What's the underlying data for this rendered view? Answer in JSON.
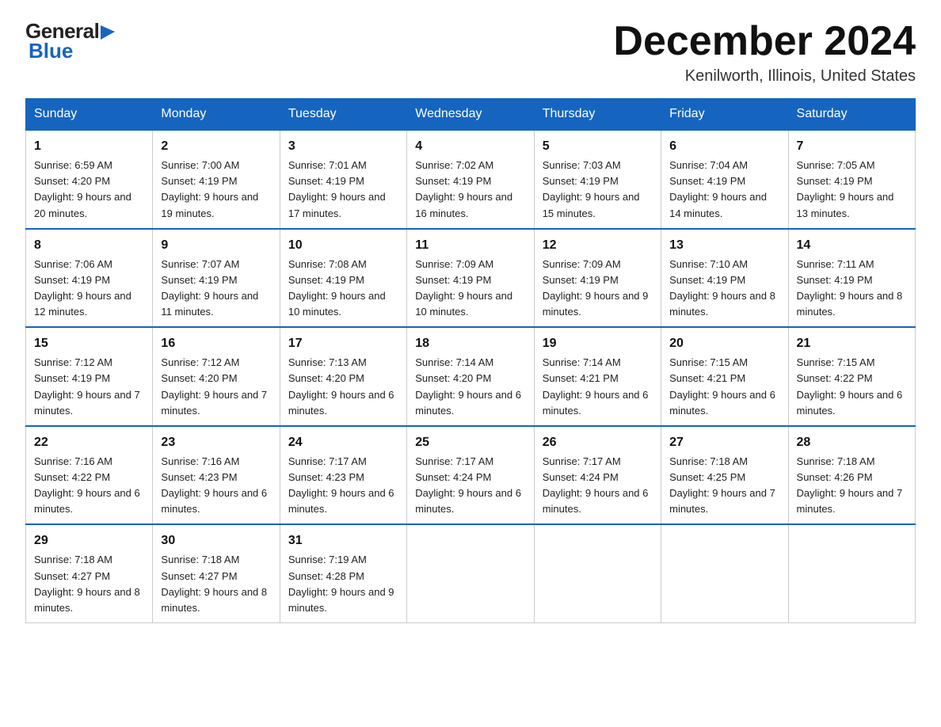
{
  "logo": {
    "general": "General",
    "blue": "Blue",
    "subtitle": "Blue"
  },
  "header": {
    "month_title": "December 2024",
    "location": "Kenilworth, Illinois, United States"
  },
  "days_of_week": [
    "Sunday",
    "Monday",
    "Tuesday",
    "Wednesday",
    "Thursday",
    "Friday",
    "Saturday"
  ],
  "weeks": [
    [
      {
        "day": "1",
        "sunrise": "Sunrise: 6:59 AM",
        "sunset": "Sunset: 4:20 PM",
        "daylight": "Daylight: 9 hours and 20 minutes."
      },
      {
        "day": "2",
        "sunrise": "Sunrise: 7:00 AM",
        "sunset": "Sunset: 4:19 PM",
        "daylight": "Daylight: 9 hours and 19 minutes."
      },
      {
        "day": "3",
        "sunrise": "Sunrise: 7:01 AM",
        "sunset": "Sunset: 4:19 PM",
        "daylight": "Daylight: 9 hours and 17 minutes."
      },
      {
        "day": "4",
        "sunrise": "Sunrise: 7:02 AM",
        "sunset": "Sunset: 4:19 PM",
        "daylight": "Daylight: 9 hours and 16 minutes."
      },
      {
        "day": "5",
        "sunrise": "Sunrise: 7:03 AM",
        "sunset": "Sunset: 4:19 PM",
        "daylight": "Daylight: 9 hours and 15 minutes."
      },
      {
        "day": "6",
        "sunrise": "Sunrise: 7:04 AM",
        "sunset": "Sunset: 4:19 PM",
        "daylight": "Daylight: 9 hours and 14 minutes."
      },
      {
        "day": "7",
        "sunrise": "Sunrise: 7:05 AM",
        "sunset": "Sunset: 4:19 PM",
        "daylight": "Daylight: 9 hours and 13 minutes."
      }
    ],
    [
      {
        "day": "8",
        "sunrise": "Sunrise: 7:06 AM",
        "sunset": "Sunset: 4:19 PM",
        "daylight": "Daylight: 9 hours and 12 minutes."
      },
      {
        "day": "9",
        "sunrise": "Sunrise: 7:07 AM",
        "sunset": "Sunset: 4:19 PM",
        "daylight": "Daylight: 9 hours and 11 minutes."
      },
      {
        "day": "10",
        "sunrise": "Sunrise: 7:08 AM",
        "sunset": "Sunset: 4:19 PM",
        "daylight": "Daylight: 9 hours and 10 minutes."
      },
      {
        "day": "11",
        "sunrise": "Sunrise: 7:09 AM",
        "sunset": "Sunset: 4:19 PM",
        "daylight": "Daylight: 9 hours and 10 minutes."
      },
      {
        "day": "12",
        "sunrise": "Sunrise: 7:09 AM",
        "sunset": "Sunset: 4:19 PM",
        "daylight": "Daylight: 9 hours and 9 minutes."
      },
      {
        "day": "13",
        "sunrise": "Sunrise: 7:10 AM",
        "sunset": "Sunset: 4:19 PM",
        "daylight": "Daylight: 9 hours and 8 minutes."
      },
      {
        "day": "14",
        "sunrise": "Sunrise: 7:11 AM",
        "sunset": "Sunset: 4:19 PM",
        "daylight": "Daylight: 9 hours and 8 minutes."
      }
    ],
    [
      {
        "day": "15",
        "sunrise": "Sunrise: 7:12 AM",
        "sunset": "Sunset: 4:19 PM",
        "daylight": "Daylight: 9 hours and 7 minutes."
      },
      {
        "day": "16",
        "sunrise": "Sunrise: 7:12 AM",
        "sunset": "Sunset: 4:20 PM",
        "daylight": "Daylight: 9 hours and 7 minutes."
      },
      {
        "day": "17",
        "sunrise": "Sunrise: 7:13 AM",
        "sunset": "Sunset: 4:20 PM",
        "daylight": "Daylight: 9 hours and 6 minutes."
      },
      {
        "day": "18",
        "sunrise": "Sunrise: 7:14 AM",
        "sunset": "Sunset: 4:20 PM",
        "daylight": "Daylight: 9 hours and 6 minutes."
      },
      {
        "day": "19",
        "sunrise": "Sunrise: 7:14 AM",
        "sunset": "Sunset: 4:21 PM",
        "daylight": "Daylight: 9 hours and 6 minutes."
      },
      {
        "day": "20",
        "sunrise": "Sunrise: 7:15 AM",
        "sunset": "Sunset: 4:21 PM",
        "daylight": "Daylight: 9 hours and 6 minutes."
      },
      {
        "day": "21",
        "sunrise": "Sunrise: 7:15 AM",
        "sunset": "Sunset: 4:22 PM",
        "daylight": "Daylight: 9 hours and 6 minutes."
      }
    ],
    [
      {
        "day": "22",
        "sunrise": "Sunrise: 7:16 AM",
        "sunset": "Sunset: 4:22 PM",
        "daylight": "Daylight: 9 hours and 6 minutes."
      },
      {
        "day": "23",
        "sunrise": "Sunrise: 7:16 AM",
        "sunset": "Sunset: 4:23 PM",
        "daylight": "Daylight: 9 hours and 6 minutes."
      },
      {
        "day": "24",
        "sunrise": "Sunrise: 7:17 AM",
        "sunset": "Sunset: 4:23 PM",
        "daylight": "Daylight: 9 hours and 6 minutes."
      },
      {
        "day": "25",
        "sunrise": "Sunrise: 7:17 AM",
        "sunset": "Sunset: 4:24 PM",
        "daylight": "Daylight: 9 hours and 6 minutes."
      },
      {
        "day": "26",
        "sunrise": "Sunrise: 7:17 AM",
        "sunset": "Sunset: 4:24 PM",
        "daylight": "Daylight: 9 hours and 6 minutes."
      },
      {
        "day": "27",
        "sunrise": "Sunrise: 7:18 AM",
        "sunset": "Sunset: 4:25 PM",
        "daylight": "Daylight: 9 hours and 7 minutes."
      },
      {
        "day": "28",
        "sunrise": "Sunrise: 7:18 AM",
        "sunset": "Sunset: 4:26 PM",
        "daylight": "Daylight: 9 hours and 7 minutes."
      }
    ],
    [
      {
        "day": "29",
        "sunrise": "Sunrise: 7:18 AM",
        "sunset": "Sunset: 4:27 PM",
        "daylight": "Daylight: 9 hours and 8 minutes."
      },
      {
        "day": "30",
        "sunrise": "Sunrise: 7:18 AM",
        "sunset": "Sunset: 4:27 PM",
        "daylight": "Daylight: 9 hours and 8 minutes."
      },
      {
        "day": "31",
        "sunrise": "Sunrise: 7:19 AM",
        "sunset": "Sunset: 4:28 PM",
        "daylight": "Daylight: 9 hours and 9 minutes."
      },
      null,
      null,
      null,
      null
    ]
  ]
}
